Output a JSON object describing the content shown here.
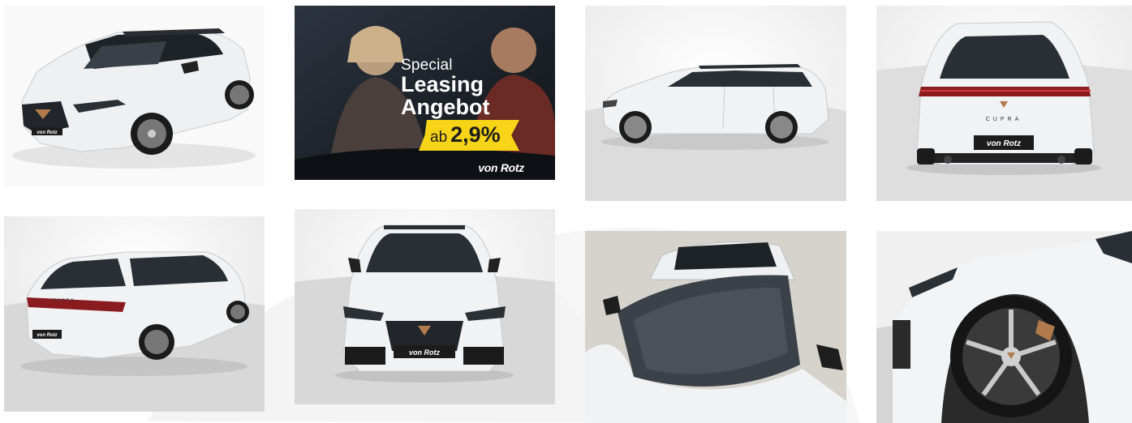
{
  "gallery": {
    "tiles": [
      {
        "name": "front-three-quarter"
      },
      {
        "name": "promo-banner"
      },
      {
        "name": "side-profile"
      },
      {
        "name": "rear-view"
      },
      {
        "name": "rear-three-quarter"
      },
      {
        "name": "front-view"
      },
      {
        "name": "panorama-roof"
      },
      {
        "name": "wheel-detail"
      }
    ]
  },
  "promo": {
    "line1": "Special",
    "line2": "Leasing",
    "line3": "Angebot",
    "badge_prefix": "ab",
    "badge_rate": "2,9%",
    "brand": "von Rotz",
    "badge_color": "#f7d417"
  },
  "plates": {
    "front": "von Rotz",
    "rear": "von Rotz"
  },
  "car": {
    "badge_text": "CUPRA",
    "body_color": "#f1f2f4",
    "accent_color": "#b07a4c"
  }
}
